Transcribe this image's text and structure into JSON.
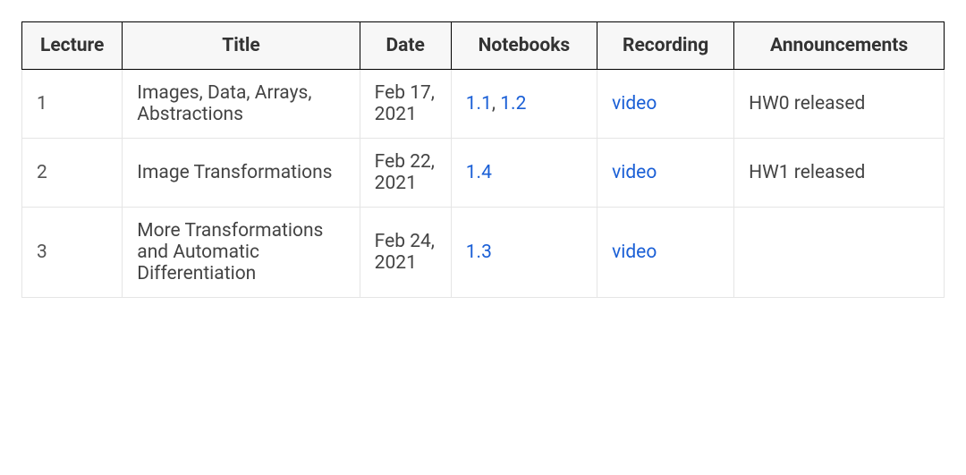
{
  "headers": {
    "lecture": "Lecture",
    "title": "Title",
    "date": "Date",
    "notebooks": "Notebooks",
    "recording": "Recording",
    "announcements": "Announcements"
  },
  "rows": [
    {
      "lecture": "1",
      "title": "Images, Data, Arrays, Abstractions",
      "date": "Feb 17, 2021",
      "notebooks": [
        "1.1",
        "1.2"
      ],
      "recording": "video",
      "announcements": "HW0 released"
    },
    {
      "lecture": "2",
      "title": "Image Transformations",
      "date": "Feb 22, 2021",
      "notebooks": [
        "1.4"
      ],
      "recording": "video",
      "announcements": "HW1 released"
    },
    {
      "lecture": "3",
      "title": "More Transformations and Automatic Differentiation",
      "date": "Feb 24, 2021",
      "notebooks": [
        "1.3"
      ],
      "recording": "video",
      "announcements": ""
    }
  ],
  "separator": ", "
}
